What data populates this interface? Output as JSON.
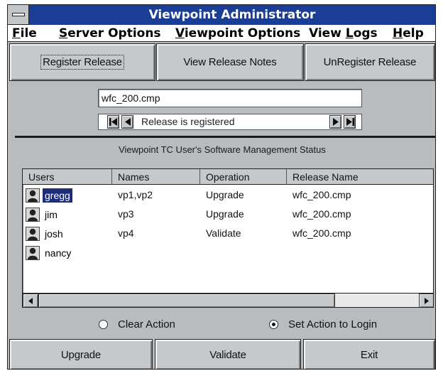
{
  "window": {
    "title": "Viewpoint Administrator"
  },
  "menu": {
    "file": {
      "mnemonic": "F",
      "rest": "ile"
    },
    "server_options": {
      "mnemonic": "S",
      "rest": "erver Options"
    },
    "viewpoint_options": {
      "mnemonic": "V",
      "rest": "iewpoint Options"
    },
    "view_logs": {
      "pre": "View ",
      "mnemonic": "L",
      "rest": "ogs"
    },
    "help": {
      "mnemonic": "H",
      "rest": "elp"
    }
  },
  "toolbar": {
    "register_release": "Register Release",
    "view_release_notes": "View Release Notes",
    "unregister_release": "UnRegister Release"
  },
  "release": {
    "file": "wfc_200.cmp",
    "status": "Release is registered"
  },
  "status_section": {
    "title": "Viewpoint TC User's Software Management Status",
    "columns": [
      "Users",
      "Names",
      "Operation",
      "Release Name"
    ],
    "rows": [
      {
        "user": "gregg",
        "names": "vp1,vp2",
        "operation": "Upgrade",
        "release": "wfc_200.cmp",
        "selected": true
      },
      {
        "user": "jim",
        "names": "vp3",
        "operation": "Upgrade",
        "release": "wfc_200.cmp",
        "selected": false
      },
      {
        "user": "josh",
        "names": "vp4",
        "operation": "Validate",
        "release": "wfc_200.cmp",
        "selected": false
      },
      {
        "user": "nancy",
        "names": "",
        "operation": "",
        "release": "",
        "selected": false
      }
    ]
  },
  "options": {
    "clear_action": "Clear Action",
    "set_action_to_login": "Set Action to Login",
    "selected": "set_action_to_login"
  },
  "actions": {
    "upgrade": "Upgrade",
    "validate": "Validate",
    "exit": "Exit"
  },
  "colors": {
    "titlebar": "#1a3e95",
    "selection": "#1e2d7a",
    "window_bg": "#b9bcbf"
  }
}
